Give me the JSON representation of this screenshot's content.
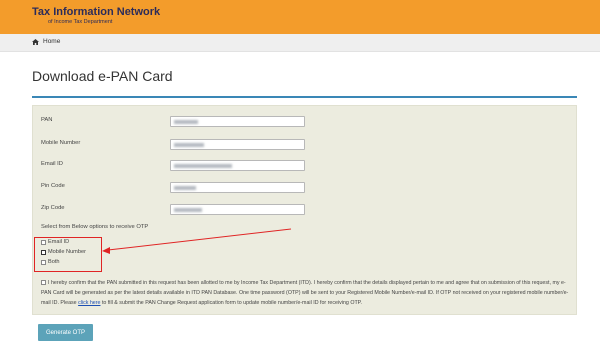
{
  "header": {
    "brand_name": "Tax Information Network",
    "brand_sub": "of Income Tax Department",
    "bg_color": "#f39c2b"
  },
  "breadcrumb": {
    "home_icon": "home-icon",
    "home_label": "Home"
  },
  "page": {
    "title": "Download e-PAN Card"
  },
  "form": {
    "fields": [
      {
        "label": "PAN"
      },
      {
        "label": "Mobile Number"
      },
      {
        "label": "Email ID"
      },
      {
        "label": "Pin Code"
      },
      {
        "label": "Zip Code"
      }
    ],
    "otp_prompt": "Select from Below options to receive OTP",
    "otp_options": [
      "Email ID",
      "Mobile Number",
      "Both"
    ],
    "confirm_text_before_link": "I hereby confirm that the PAN submitted in this request has been allotted to me by Income Tax Department (ITD). I hereby confirm that the details displayed pertain to me and agree that on submission of this request, my e-PAN Card will be generated as per the latest details available in ITD PAN Database. One time password (OTP) will be sent to your Registered Mobile Number/e-mail ID. If OTP not received on your registered mobile number/e-mail ID. Please ",
    "confirm_link_text": "click here",
    "confirm_text_after_link": " to fill & submit the PAN Change Request application form to update mobile number/e-mail ID for receiving OTP.",
    "submit_label": "Generate OTP"
  },
  "colors": {
    "accent": "#3a87b6",
    "panel": "#ececdf",
    "button": "#5ca3b9",
    "annotation": "#e02424"
  }
}
